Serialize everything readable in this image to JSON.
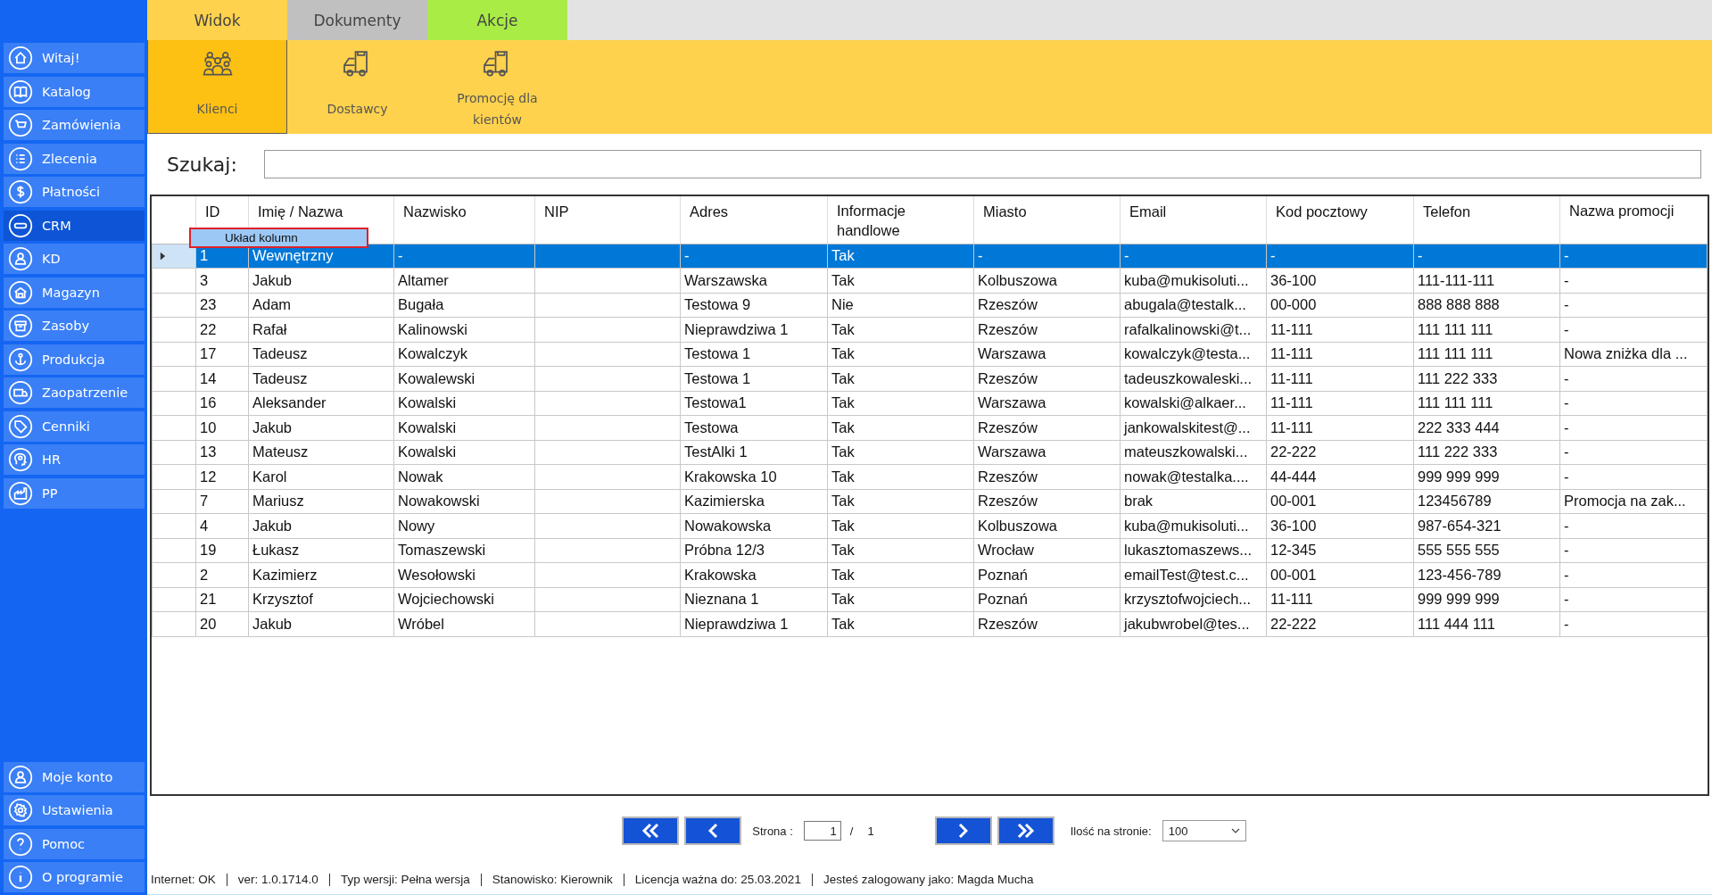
{
  "sidebar": {
    "items": [
      {
        "label": "Witaj!",
        "selected": false
      },
      {
        "label": "Katalog",
        "selected": false
      },
      {
        "label": "Zamówienia",
        "selected": false
      },
      {
        "label": "Zlecenia",
        "selected": false
      },
      {
        "label": "Płatności",
        "selected": false
      },
      {
        "label": "CRM",
        "selected": true
      },
      {
        "label": "KD",
        "selected": false
      },
      {
        "label": "Magazyn",
        "selected": false
      },
      {
        "label": "Zasoby",
        "selected": false
      },
      {
        "label": "Produkcja",
        "selected": false
      },
      {
        "label": "Zaopatrzenie",
        "selected": false
      },
      {
        "label": "Cenniki",
        "selected": false
      },
      {
        "label": "HR",
        "selected": false
      },
      {
        "label": "PP",
        "selected": false
      }
    ],
    "bottom_items": [
      {
        "label": "Moje konto"
      },
      {
        "label": "Ustawienia"
      },
      {
        "label": "Pomoc"
      },
      {
        "label": "O programie"
      }
    ]
  },
  "tabs": [
    {
      "label": "Widok",
      "color": "#ffd24d"
    },
    {
      "label": "Dokumenty",
      "color": "#c0c0c0"
    },
    {
      "label": "Akcje",
      "color": "#a8ec45"
    }
  ],
  "ribbon": [
    {
      "label": "Klienci",
      "selected": true
    },
    {
      "label": "Dostawcy",
      "selected": false
    },
    {
      "label": "Promocję dla kientów",
      "selected": false
    }
  ],
  "search": {
    "label": "Szukaj:"
  },
  "table": {
    "columns": [
      "ID",
      "Imię / Nazwa",
      "Nazwisko",
      "NIP",
      "Adres",
      "Informacje handlowe",
      "Miasto",
      "Email",
      "Kod pocztowy",
      "Telefon",
      "Nazwa promocji"
    ],
    "rows": [
      {
        "selected": true,
        "cells": [
          "1",
          "Wewnętrzny",
          "-",
          "",
          "-",
          "Tak",
          "-",
          "-",
          "-",
          "-",
          "-"
        ]
      },
      {
        "selected": false,
        "cells": [
          "3",
          "Jakub",
          "Altamer",
          "",
          "Warszawska",
          "Tak",
          "Kolbuszowa",
          "kuba@mukisoluti...",
          "36-100",
          "111-111-111",
          "-"
        ]
      },
      {
        "selected": false,
        "cells": [
          "23",
          "Adam",
          "Bugała",
          "",
          "Testowa 9",
          "Nie",
          "Rzeszów",
          "abugala@testalk...",
          "00-000",
          "888 888 888",
          "-"
        ]
      },
      {
        "selected": false,
        "cells": [
          "22",
          "Rafał",
          "Kalinowski",
          "",
          "Nieprawdziwa 1",
          "Tak",
          "Rzeszów",
          "rafalkalinowski@t...",
          "11-111",
          "111 111 111",
          "-"
        ]
      },
      {
        "selected": false,
        "cells": [
          "17",
          "Tadeusz",
          "Kowalczyk",
          "",
          "Testowa 1",
          "Tak",
          "Warszawa",
          "kowalczyk@testa...",
          "11-111",
          "111 111 111",
          "Nowa zniżka dla ..."
        ]
      },
      {
        "selected": false,
        "cells": [
          "14",
          "Tadeusz",
          "Kowalewski",
          "",
          "Testowa 1",
          "Tak",
          "Rzeszów",
          "tadeuszkowaleski...",
          "11-111",
          "111 222 333",
          "-"
        ]
      },
      {
        "selected": false,
        "cells": [
          "16",
          "Aleksander",
          "Kowalski",
          "",
          "Testowa1",
          "Tak",
          "Warszawa",
          "kowalski@alkaer...",
          "11-111",
          "111 111 111",
          "-"
        ]
      },
      {
        "selected": false,
        "cells": [
          "10",
          "Jakub",
          "Kowalski",
          "",
          "Testowa",
          "Tak",
          "Rzeszów",
          "jankowalskitest@...",
          "11-111",
          "222 333 444",
          "-"
        ]
      },
      {
        "selected": false,
        "cells": [
          "13",
          "Mateusz",
          "Kowalski",
          "",
          "TestAlki 1",
          "Tak",
          "Warszawa",
          "mateuszkowalski...",
          "22-222",
          "111 222 333",
          "-"
        ]
      },
      {
        "selected": false,
        "cells": [
          "12",
          "Karol",
          "Nowak",
          "",
          "Krakowska 10",
          "Tak",
          "Rzeszów",
          "nowak@testalka....",
          "44-444",
          "999 999 999",
          "-"
        ]
      },
      {
        "selected": false,
        "cells": [
          "7",
          "Mariusz",
          "Nowakowski",
          "",
          "Kazimierska",
          "Tak",
          "Rzeszów",
          "brak",
          "00-001",
          "123456789",
          "Promocja na zak..."
        ]
      },
      {
        "selected": false,
        "cells": [
          "4",
          "Jakub",
          "Nowy",
          "",
          "Nowakowska",
          "Tak",
          "Kolbuszowa",
          "kuba@mukisoluti...",
          "36-100",
          "987-654-321",
          "-"
        ]
      },
      {
        "selected": false,
        "cells": [
          "19",
          "Łukasz",
          "Tomaszewski",
          "",
          "Próbna 12/3",
          "Tak",
          "Wrocław",
          "lukasztomaszews...",
          "12-345",
          "555 555 555",
          "-"
        ]
      },
      {
        "selected": false,
        "cells": [
          "2",
          "Kazimierz",
          "Wesołowski",
          "",
          "Krakowska",
          "Tak",
          "Poznań",
          "emailTest@test.c...",
          "00-001",
          "123-456-789",
          "-"
        ]
      },
      {
        "selected": false,
        "cells": [
          "21",
          "Krzysztof",
          "Wojciechowski",
          "",
          "Nieznana 1",
          "Tak",
          "Poznań",
          "krzysztofwojciech...",
          "11-111",
          "999 999 999",
          "-"
        ]
      },
      {
        "selected": false,
        "cells": [
          "20",
          "Jakub",
          "Wróbel",
          "",
          "Nieprawdziwa 1",
          "Tak",
          "Rzeszów",
          "jakubwrobel@tes...",
          "22-222",
          "111 444 111",
          "-"
        ]
      }
    ]
  },
  "context_menu": {
    "items": [
      "Układ kolumn"
    ]
  },
  "pagination": {
    "page_label": "Strona :",
    "page": "1",
    "separator": "/",
    "total": "1",
    "per_page_label": "Ilość na stronie:",
    "per_page": "100"
  },
  "status_bar": [
    "Internet: OK",
    "ver: 1.0.1714.0",
    "Typ wersji: Pełna wersja",
    "Stanowisko: Kierownik",
    "Licencja ważna do: 25.03.2021",
    "Jesteś zalogowany jako: Magda Mucha"
  ]
}
